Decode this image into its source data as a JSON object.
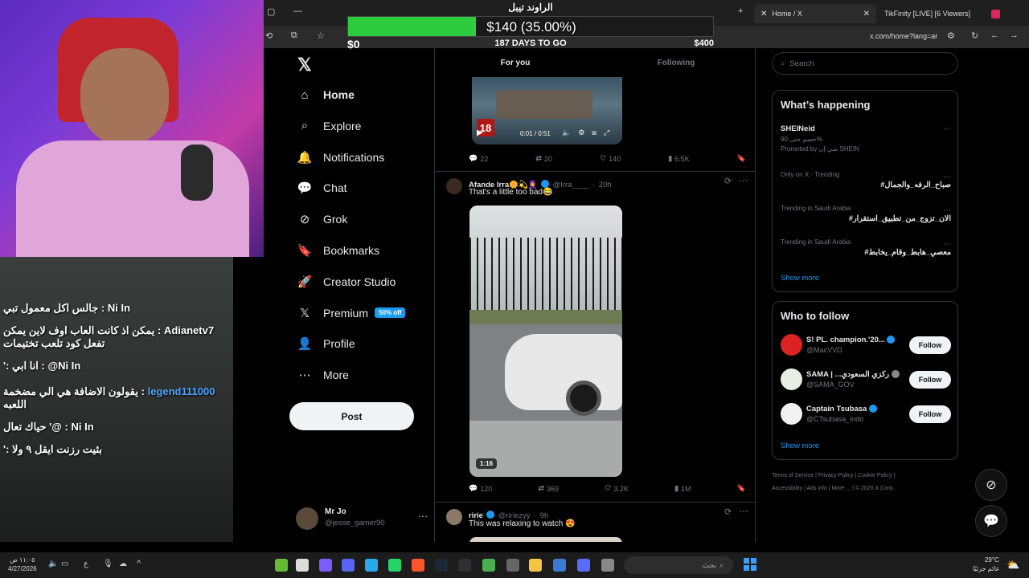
{
  "stream_goal": {
    "title": "الراوند تيبل",
    "amount": "$140 (35.00%)",
    "progress_fraction": 0.35,
    "min_label": "$0",
    "days_left": "187 DAYS TO GO",
    "max_label": "$400"
  },
  "browser": {
    "tabs": [
      {
        "label": "Home / X",
        "icon": "x-logo-icon",
        "active": true
      },
      {
        "label": "TikFinity [LIVE] [6 Viewers]",
        "icon": "tikfinity-icon",
        "active": false
      }
    ],
    "url": "x.com/home?lang=ar"
  },
  "sidebar": {
    "items": [
      {
        "label": "Home",
        "icon": "home-icon"
      },
      {
        "label": "Explore",
        "icon": "search-icon"
      },
      {
        "label": "Notifications",
        "icon": "bell-icon"
      },
      {
        "label": "Chat",
        "icon": "chat-icon"
      },
      {
        "label": "Grok",
        "icon": "grok-icon"
      },
      {
        "label": "Bookmarks",
        "icon": "bookmark-icon"
      },
      {
        "label": "Creator Studio",
        "icon": "rocket-icon"
      },
      {
        "label": "Premium",
        "icon": "x-logo-icon",
        "badge": "50% off"
      },
      {
        "label": "Profile",
        "icon": "person-icon"
      },
      {
        "label": "More",
        "icon": "more-circle-icon"
      }
    ],
    "post_label": "Post",
    "account": {
      "name": "Mr Jo",
      "handle": "@jesse_gamer90"
    }
  },
  "feed": {
    "tabs": [
      "For you",
      "Following"
    ],
    "tweet1": {
      "video_time": "0:01 / 0:51",
      "age_badge": "18",
      "replies": "22",
      "reposts": "20",
      "likes": "140",
      "views": "6.5K"
    },
    "tweet2": {
      "name": "Afande Irra🌼💫🧕",
      "handle": "@Irra____",
      "time": "20h",
      "text": "That's a little too bad😂",
      "duration": "1:16",
      "replies": "120",
      "reposts": "369",
      "likes": "3.2K",
      "views": "1M"
    },
    "tweet3": {
      "name": "ririe",
      "handle": "@ririezyy",
      "time": "9h",
      "text": "This was relaxing to watch 😍"
    }
  },
  "right": {
    "search_placeholder": "Search",
    "whats_happening_title": "What’s happening",
    "trends": [
      {
        "meta": "",
        "title": "SHEINeid",
        "sub": "خصم حتى 90%",
        "promo": "Promoted by شي إن SHEIN"
      },
      {
        "meta": "Only on X · Trending",
        "title": "#صباح_الرفه_والجمال"
      },
      {
        "meta": "Trending in Saudi Arabia",
        "title": "#الان_تزوج_من_تطبيق_استقرار"
      },
      {
        "meta": "Trending in Saudi Arabia",
        "title": "#معصي_هابط_وقام_يخابط"
      }
    ],
    "show_more": "Show more",
    "who_to_follow_title": "Who to follow",
    "follow": [
      {
        "name": "S! PL. champion.'20...",
        "handle": "@MacVVD",
        "button": "Follow"
      },
      {
        "name": "SAMA | ...ركزي السعودي",
        "handle": "@SAMA_GOV",
        "button": "Follow"
      },
      {
        "name": "Captain Tsubasa",
        "handle": "@CTsubasa_indo",
        "button": "Follow"
      }
    ],
    "footer_line1": [
      "Terms of Service",
      "Privacy Policy",
      "Cookie Policy"
    ],
    "footer_line2": [
      "Accessibility",
      "Ads info",
      "More ...",
      "© 2026 X Corp."
    ]
  },
  "stream_chat": [
    {
      "user": "Ni In",
      "text": "جالس اكل معمول تبي"
    },
    {
      "user": "Adianetv7",
      "text": "يمكن اذ كانت العاب اوف لاين يمكن تفعل كود تلعب تختيمات"
    },
    {
      "user": "Ni In@",
      "text": "انا ابي :'"
    },
    {
      "user": "legend111000",
      "text": "يقولون الاضافة هي الي مضخمة اللعبه"
    },
    {
      "user": "Ni In",
      "text": "@' حياك تعال"
    },
    {
      "user": "",
      "text": "بثيت رزنت ايقل ٩ ولا :'"
    }
  ],
  "taskbar": {
    "time": "١١:٠٥ ص",
    "date": "4/27/2026",
    "lang": "ع",
    "search_placeholder": "بحث",
    "weather_temp": "29°C",
    "weather_desc": "غائم جزئيًا"
  }
}
